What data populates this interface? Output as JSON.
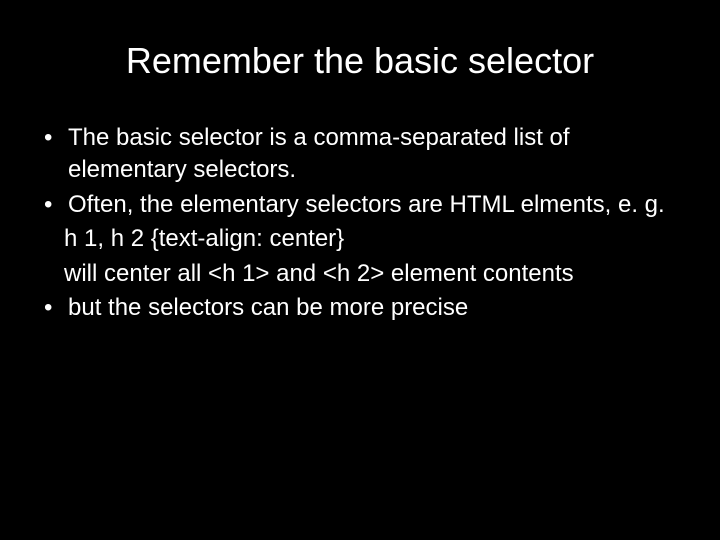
{
  "slide": {
    "title": "Remember the basic selector",
    "bullet1": "The basic selector is a comma-separated list of elementary  selectors.",
    "bullet2": "Often, the elementary selectors are HTML elments, e. g.",
    "sub1": "h 1, h 2 {text-align: center}",
    "sub2": "will center all <h 1> and <h 2> element contents",
    "bullet3": "but the selectors can be more precise",
    "marker": "•"
  }
}
